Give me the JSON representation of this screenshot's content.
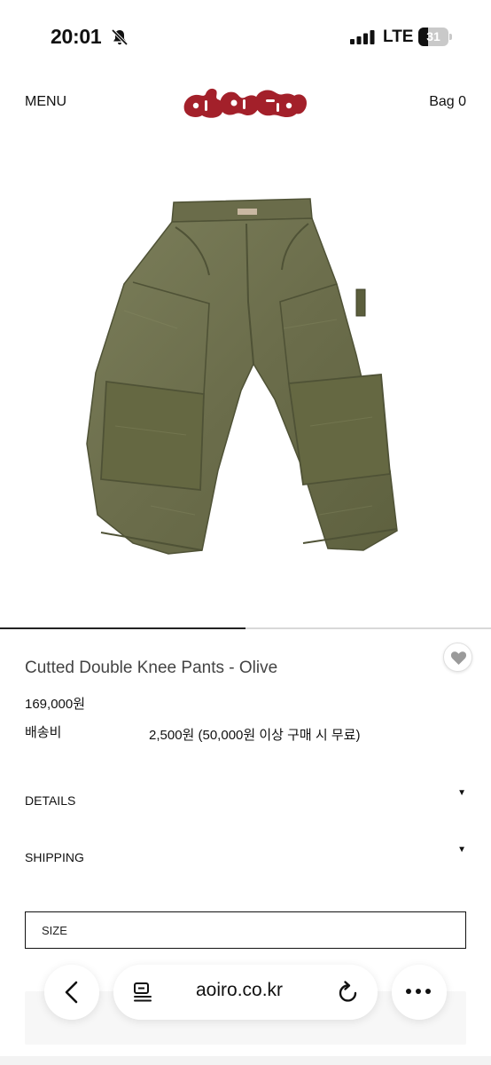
{
  "status_bar": {
    "time": "20:01",
    "network": "LTE",
    "battery_level": "31",
    "battery_fraction": 0.31
  },
  "header": {
    "menu_label": "MENU",
    "bag_label": "Bag 0",
    "logo_color": "#a3202a"
  },
  "product": {
    "image_icon": "olive-double-knee-pants-photo",
    "image_carousel_progress": 0.5,
    "title": "Cutted Double Knee Pants - Olive",
    "price": "169,000원",
    "shipping_label": "배송비",
    "shipping_value": "2,500원 (50,000원 이상 구매 시 무료)"
  },
  "accordions": [
    {
      "label": "DETAILS",
      "arrow": "▼"
    },
    {
      "label": "SHIPPING",
      "arrow": "▼"
    }
  ],
  "size_select": {
    "placeholder": "SIZE"
  },
  "browser": {
    "url": "aoiro.co.kr",
    "icons": [
      "back-icon",
      "tabs-icon",
      "reload-icon",
      "more-icon"
    ]
  }
}
